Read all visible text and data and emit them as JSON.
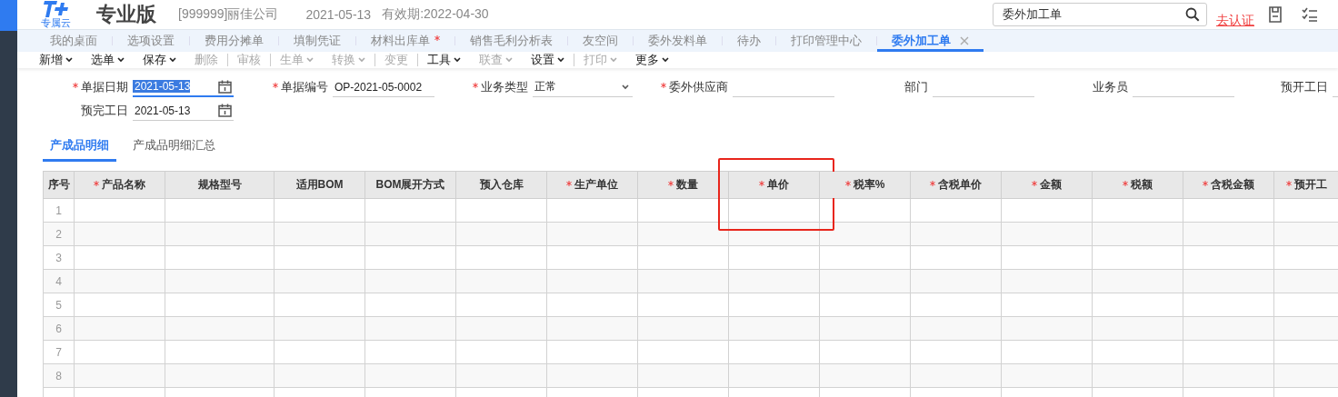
{
  "header": {
    "logo_caption": "专属云",
    "edition": "专业版",
    "company": "[999999]丽佳公司",
    "date": "2021-05-13",
    "validity": "有效期:2022-04-30",
    "search": {
      "value": "委外加工单"
    },
    "verify_link": "去认证"
  },
  "tabs": [
    {
      "label": "我的桌面",
      "selected": false,
      "modified": false,
      "closable": false
    },
    {
      "label": "选项设置",
      "selected": false,
      "modified": false,
      "closable": false
    },
    {
      "label": "费用分摊单",
      "selected": false,
      "modified": false,
      "closable": false
    },
    {
      "label": "填制凭证",
      "selected": false,
      "modified": false,
      "closable": false
    },
    {
      "label": "材料出库单",
      "selected": false,
      "modified": true,
      "closable": false
    },
    {
      "label": "销售毛利分析表",
      "selected": false,
      "modified": false,
      "closable": false
    },
    {
      "label": "友空间",
      "selected": false,
      "modified": false,
      "closable": false
    },
    {
      "label": "委外发料单",
      "selected": false,
      "modified": false,
      "closable": false
    },
    {
      "label": "待办",
      "selected": false,
      "modified": false,
      "closable": false
    },
    {
      "label": "打印管理中心",
      "selected": false,
      "modified": false,
      "closable": false
    },
    {
      "label": "委外加工单",
      "selected": true,
      "modified": false,
      "closable": true
    }
  ],
  "toolbar": [
    {
      "label": "新增",
      "disabled": false,
      "dropdown": true,
      "separator_before": false
    },
    {
      "label": "选单",
      "disabled": false,
      "dropdown": true,
      "separator_before": false
    },
    {
      "label": "保存",
      "disabled": false,
      "dropdown": true,
      "separator_before": false
    },
    {
      "label": "删除",
      "disabled": true,
      "dropdown": false,
      "separator_before": false
    },
    {
      "label": "审核",
      "disabled": true,
      "dropdown": false,
      "separator_before": true
    },
    {
      "label": "生单",
      "disabled": true,
      "dropdown": true,
      "separator_before": true
    },
    {
      "label": "转换",
      "disabled": true,
      "dropdown": true,
      "separator_before": false
    },
    {
      "label": "变更",
      "disabled": true,
      "dropdown": false,
      "separator_before": true
    },
    {
      "label": "工具",
      "disabled": false,
      "dropdown": true,
      "separator_before": true
    },
    {
      "label": "联查",
      "disabled": true,
      "dropdown": true,
      "separator_before": false
    },
    {
      "label": "设置",
      "disabled": false,
      "dropdown": true,
      "separator_before": false
    },
    {
      "label": "打印",
      "disabled": true,
      "dropdown": true,
      "separator_before": true
    },
    {
      "label": "更多",
      "disabled": false,
      "dropdown": true,
      "separator_before": false
    }
  ],
  "form": {
    "rows": [
      [
        {
          "label": "单据日期",
          "required": true,
          "kind": "date",
          "value": "2021-05-13",
          "focused": true
        },
        {
          "label": "单据编号",
          "required": true,
          "kind": "text",
          "value": "OP-2021-05-0002",
          "focused": false
        },
        {
          "label": "业务类型",
          "required": true,
          "kind": "select",
          "value": "正常",
          "focused": false
        },
        {
          "label": "委外供应商",
          "required": true,
          "kind": "text",
          "focused": false
        },
        {
          "label": "部门",
          "required": false,
          "kind": "text",
          "focused": false
        },
        {
          "label": "业务员",
          "required": false,
          "kind": "text",
          "focused": false
        },
        {
          "label": "预开工日",
          "required": false,
          "kind": "text",
          "focused": false
        }
      ],
      [
        {
          "label": "预完工日",
          "required": false,
          "kind": "date",
          "value": "2021-05-13",
          "focused": false
        }
      ]
    ]
  },
  "sub_tabs": [
    {
      "label": "产成品明细",
      "selected": true
    },
    {
      "label": "产成品明细汇总",
      "selected": false
    }
  ],
  "table": {
    "columns": [
      {
        "label": "序号",
        "required": false,
        "highlighted": false
      },
      {
        "label": "产品名称",
        "required": true,
        "highlighted": false
      },
      {
        "label": "规格型号",
        "required": false,
        "highlighted": false
      },
      {
        "label": "适用BOM",
        "required": false,
        "highlighted": false
      },
      {
        "label": "BOM展开方式",
        "required": false,
        "highlighted": false
      },
      {
        "label": "预入仓库",
        "required": false,
        "highlighted": false
      },
      {
        "label": "生产单位",
        "required": true,
        "highlighted": false
      },
      {
        "label": "数量",
        "required": true,
        "highlighted": false
      },
      {
        "label": "单价",
        "required": true,
        "highlighted": true
      },
      {
        "label": "税率%",
        "required": true,
        "highlighted": false
      },
      {
        "label": "含税单价",
        "required": true,
        "highlighted": false
      },
      {
        "label": "金额",
        "required": true,
        "highlighted": false
      },
      {
        "label": "税额",
        "required": true,
        "highlighted": false
      },
      {
        "label": "含税金额",
        "required": true,
        "highlighted": false
      },
      {
        "label": "预开工",
        "required": true,
        "highlighted": false
      }
    ],
    "rows": [
      {
        "number": "1"
      },
      {
        "number": "2"
      },
      {
        "number": "3"
      },
      {
        "number": "4"
      },
      {
        "number": "5"
      },
      {
        "number": "6"
      },
      {
        "number": "7"
      },
      {
        "number": "8"
      }
    ]
  }
}
